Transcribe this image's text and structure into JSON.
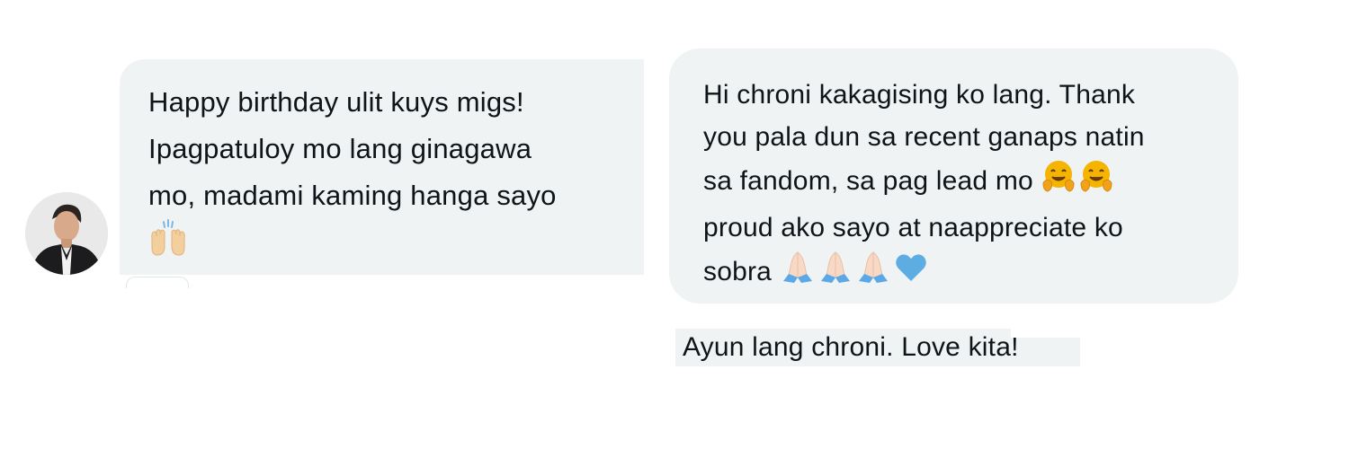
{
  "messages": {
    "received": {
      "lines": [
        "Happy birthday ulit kuys migs!",
        "Ipagpatuloy mo lang ginagawa",
        "mo, madami kaming hanga sayo"
      ],
      "emoji": "raising-hands-emoji"
    },
    "sent": {
      "lines": [
        "Hi chroni kakagising ko lang. Thank",
        "you pala dun sa recent ganaps natin",
        "sa fandom, sa pag lead mo",
        "proud ako sayo at naappreciate ko",
        "sobra"
      ],
      "emoji_after_line_3": [
        "hugging-face-emoji",
        "hugging-face-emoji"
      ],
      "emoji_after_line_5": [
        "folded-hands-emoji",
        "folded-hands-emoji",
        "folded-hands-emoji",
        "blue-heart-emoji"
      ]
    },
    "sent_followup": {
      "text": "Ayun lang chroni. Love kita!"
    }
  },
  "colors": {
    "bubble_bg": "#eff3f4",
    "text": "#0f1419",
    "heart": "#5dade2",
    "hug_face": "#f4b400",
    "hands_light": "#f8d9c6",
    "hands_sleeve": "#5aa9e6",
    "raise_hands": "#f2cf9c"
  }
}
